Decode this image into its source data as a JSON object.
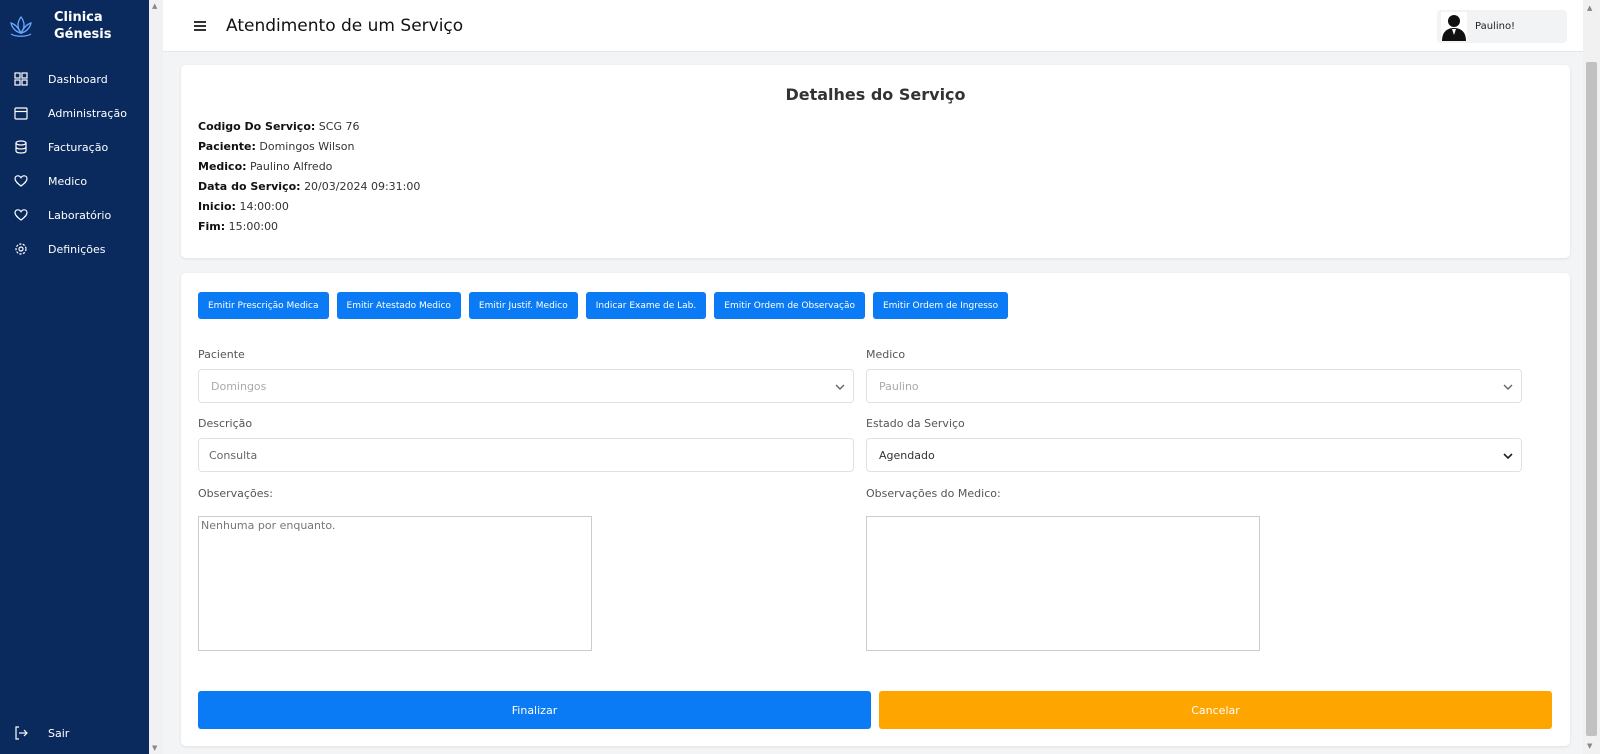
{
  "brand": {
    "line1": "Clinica",
    "line2": "Génesis"
  },
  "sidebar": {
    "items": [
      {
        "label": "Dashboard",
        "icon": "grid-icon"
      },
      {
        "label": "Administração",
        "icon": "calendar-icon"
      },
      {
        "label": "Facturação",
        "icon": "database-icon"
      },
      {
        "label": "Medico",
        "icon": "heart-icon"
      },
      {
        "label": "Laboratório",
        "icon": "heart-icon"
      },
      {
        "label": "Definições",
        "icon": "gear-icon"
      }
    ],
    "logout_label": "Sair"
  },
  "header": {
    "title": "Atendimento de um Serviço",
    "user_name": "Paulino!"
  },
  "details": {
    "title": "Detalhes do Serviço",
    "rows": [
      {
        "label": "Codigo Do Serviço:",
        "value": "SCG 76"
      },
      {
        "label": "Paciente:",
        "value": "Domingos Wilson"
      },
      {
        "label": "Medico:",
        "value": "Paulino Alfredo"
      },
      {
        "label": "Data do Serviço:",
        "value": "20/03/2024 09:31:00"
      },
      {
        "label": "Inicio:",
        "value": "14:00:00"
      },
      {
        "label": "Fim:",
        "value": "15:00:00"
      }
    ]
  },
  "actions": [
    "Emitir Prescrição Medica",
    "Emitir Atestado Medico",
    "Emitir Justif. Medico",
    "Indicar Exame de Lab.",
    "Emitir Ordem de Observação",
    "Emitir Ordem de Ingresso"
  ],
  "form": {
    "paciente_label": "Paciente",
    "paciente_value": "Domingos",
    "medico_label": "Medico",
    "medico_value": "Paulino",
    "descricao_label": "Descrição",
    "descricao_value": "Consulta",
    "estado_label": "Estado da Serviço",
    "estado_value": "Agendado",
    "observacoes_label": "Observações:",
    "observacoes_value": "Nenhuma por enquanto.",
    "obs_medico_label": "Observações do Medico:",
    "obs_medico_value": ""
  },
  "buttons": {
    "finalizar": "Finalizar",
    "cancelar": "Cancelar"
  },
  "colors": {
    "sidebar_bg": "#0a2a5e",
    "primary": "#0b7bf5",
    "warning": "#ffa500"
  }
}
